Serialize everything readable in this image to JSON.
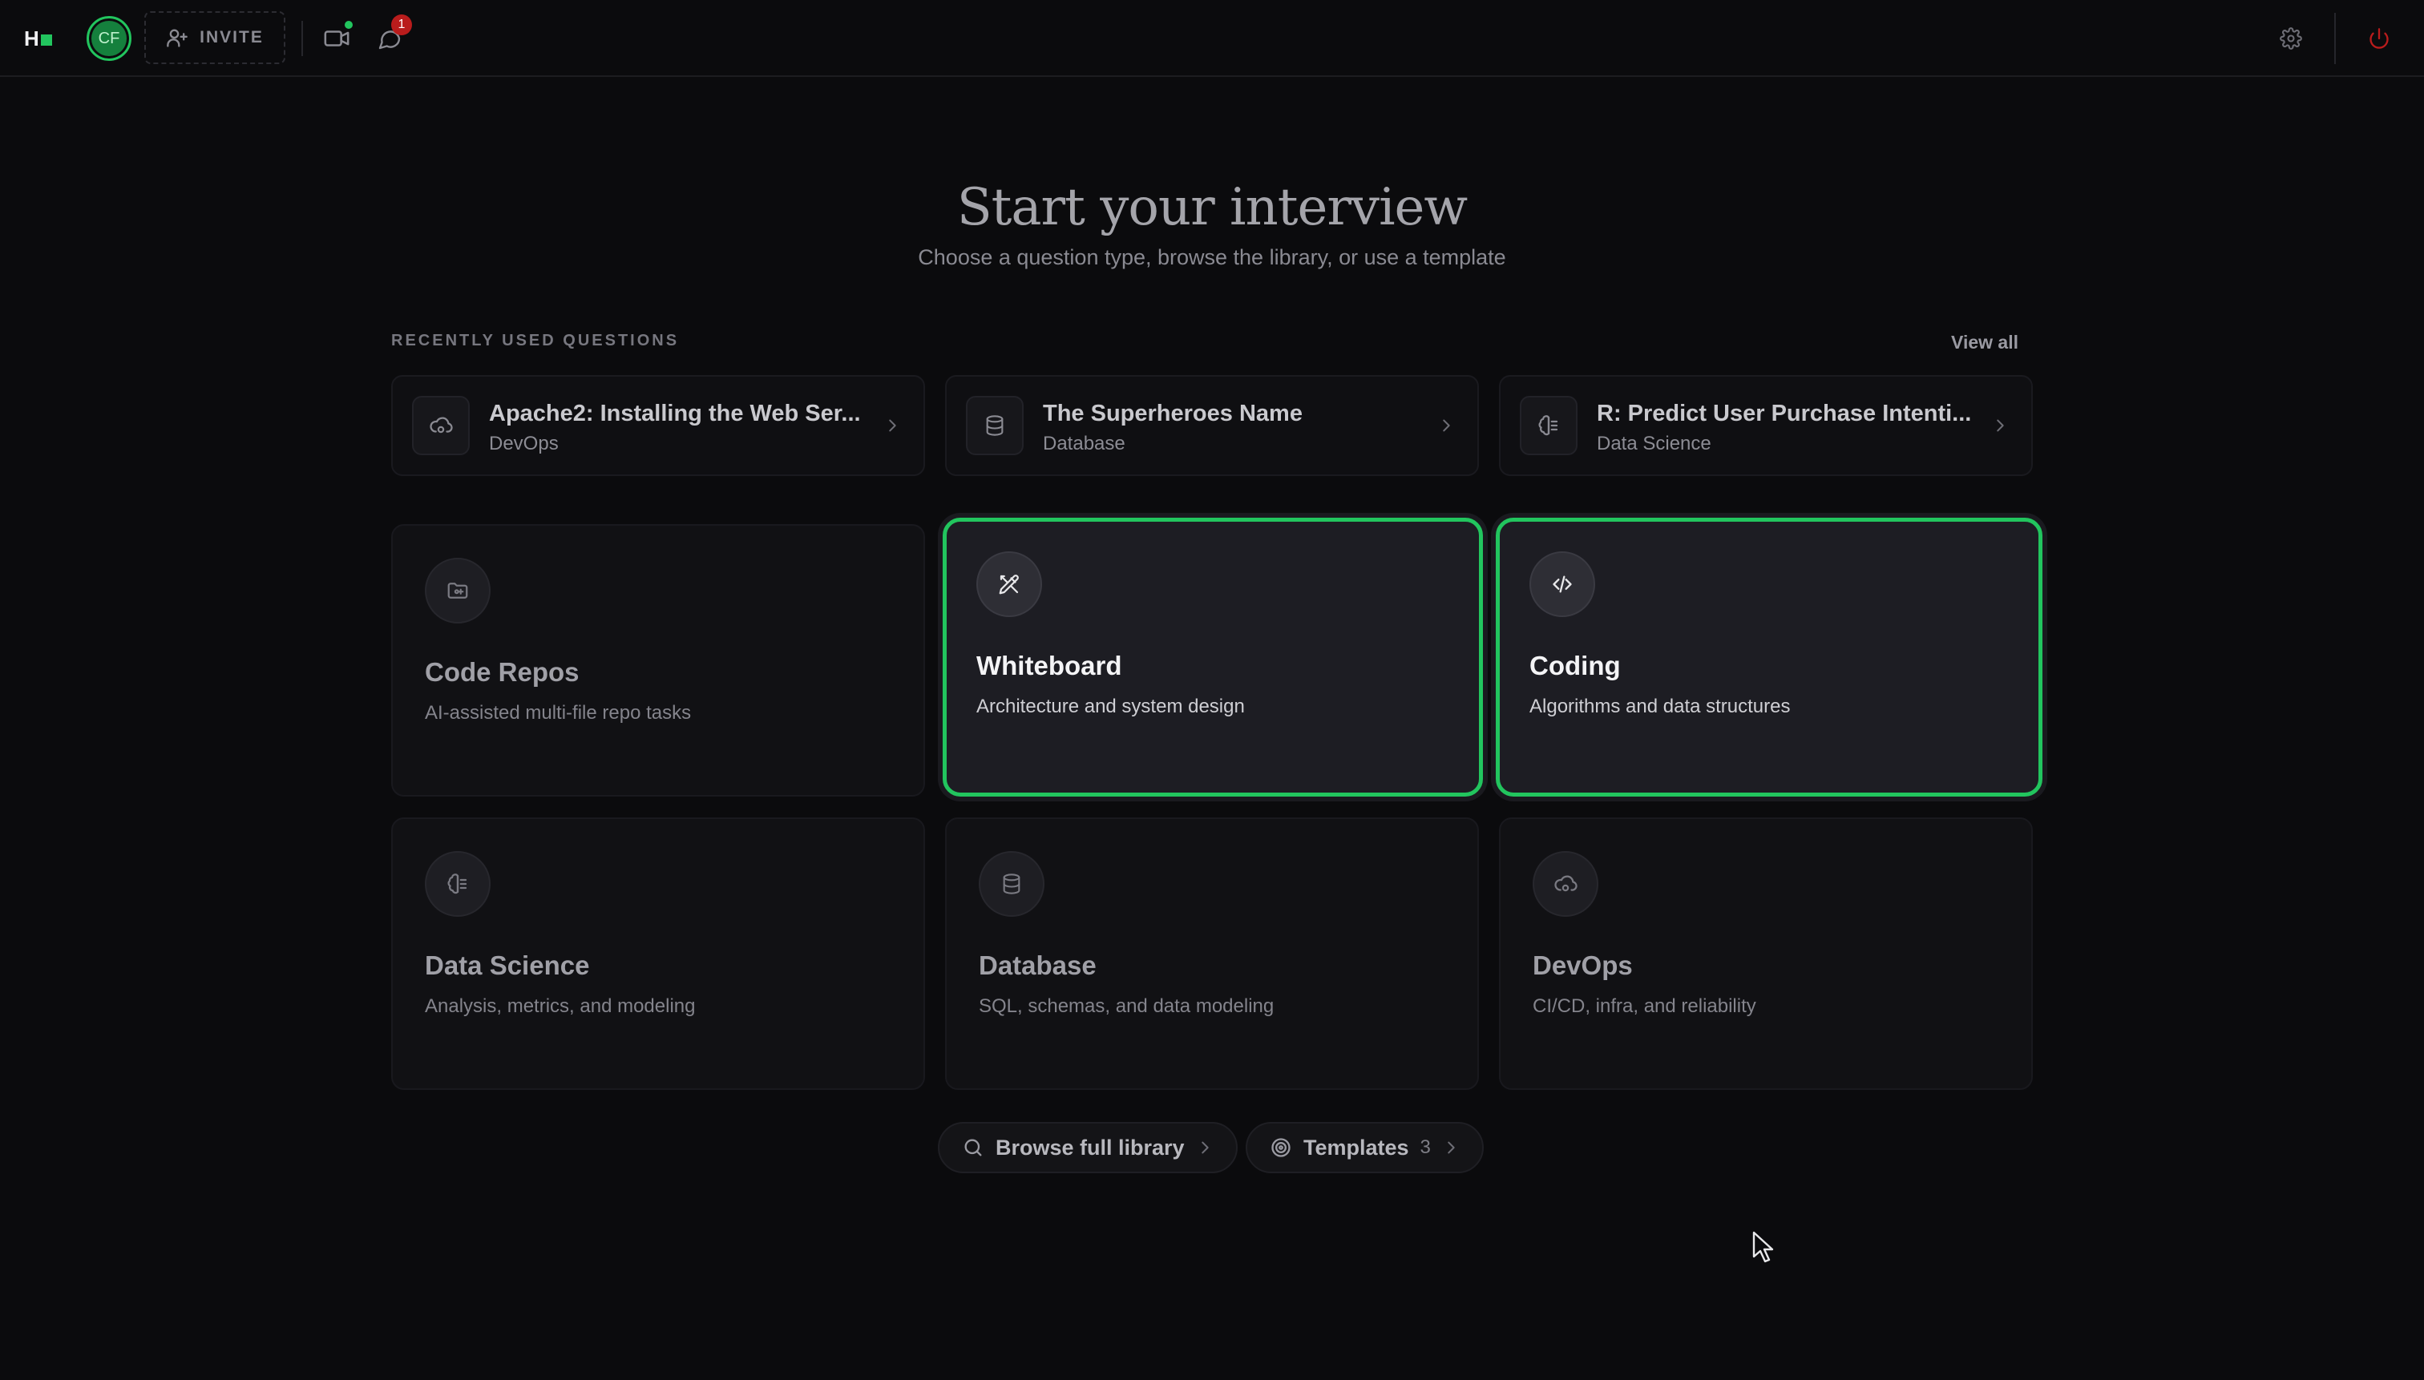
{
  "topbar": {
    "logo_text": "H",
    "avatar_initials": "CF",
    "invite_label": "INVITE",
    "notification_count": "1",
    "icons": [
      "user-plus-icon",
      "video-icon",
      "chat-icon",
      "gear-icon",
      "power-icon"
    ],
    "colors": {
      "accent": "#22c55e",
      "badge": "#b91c1c",
      "power": "#b91c1c"
    }
  },
  "header": {
    "title": "Start your interview",
    "subtitle": "Choose a question type, browse the library, or use a template"
  },
  "recent": {
    "label": "RECENTLY USED QUESTIONS",
    "view_all": "View all",
    "items": [
      {
        "title": "Apache2: Installing the Web Ser...",
        "category": "DevOps",
        "icon": "cloud-cog-icon"
      },
      {
        "title": "The Superheroes Name",
        "category": "Database",
        "icon": "database-icon"
      },
      {
        "title": "R: Predict User Purchase Intenti...",
        "category": "Data Science",
        "icon": "brain-icon"
      }
    ]
  },
  "types": [
    {
      "title": "Code Repos",
      "desc": "AI-assisted multi-file repo tasks",
      "icon": "folder-git-icon",
      "selected": false
    },
    {
      "title": "Whiteboard",
      "desc": "Architecture and system design",
      "icon": "pencil-ruler-icon",
      "selected": true
    },
    {
      "title": "Coding",
      "desc": "Algorithms and data structures",
      "icon": "code-icon",
      "selected": true
    },
    {
      "title": "Data Science",
      "desc": "Analysis, metrics, and modeling",
      "icon": "brain-icon",
      "selected": false
    },
    {
      "title": "Database",
      "desc": "SQL, schemas, and data modeling",
      "icon": "database-icon",
      "selected": false
    },
    {
      "title": "DevOps",
      "desc": "CI/CD, infra, and reliability",
      "icon": "cloud-cog-icon",
      "selected": false
    }
  ],
  "actions": {
    "browse_label": "Browse full library",
    "templates_label": "Templates",
    "templates_count": "3"
  }
}
